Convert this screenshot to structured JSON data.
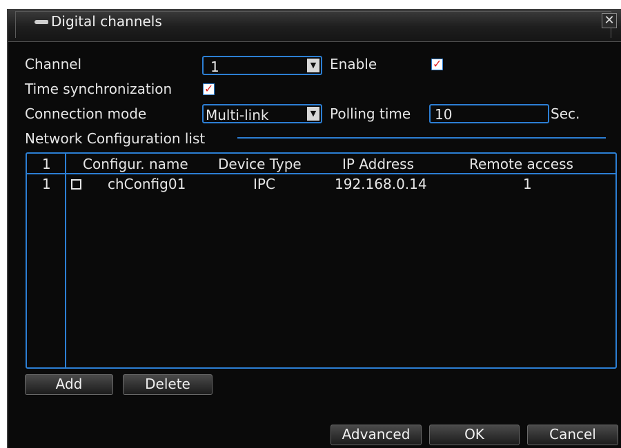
{
  "dialog": {
    "title": "Digital channels",
    "close_symbol": "✕"
  },
  "form": {
    "channel_label": "Channel",
    "channel_value": "1",
    "enable_label": "Enable",
    "enable_checked": true,
    "time_sync_label": "Time synchronization",
    "time_sync_checked": true,
    "connection_mode_label": "Connection mode",
    "connection_mode_value": "Multi-link",
    "polling_time_label": "Polling time",
    "polling_time_value": "10",
    "polling_unit": "Sec.",
    "check_symbol": "✓",
    "dropdown_arrow": "▼"
  },
  "network_list": {
    "label": "Network Configuration list",
    "header": {
      "index": "1",
      "config_name": "Configur. name",
      "device_type": "Device Type",
      "ip_address": "IP Address",
      "remote_access": "Remote access"
    },
    "rows": [
      {
        "index": "1",
        "checked": false,
        "config_name": "chConfig01",
        "device_type": "IPC",
        "ip_address": "192.168.0.14",
        "remote_access": "1"
      }
    ]
  },
  "buttons": {
    "add": "Add",
    "delete": "Delete",
    "advanced": "Advanced",
    "ok": "OK",
    "cancel": "Cancel"
  },
  "colors": {
    "accent": "#2c7fd4",
    "check": "#e02020",
    "background": "#0a0a0a"
  }
}
